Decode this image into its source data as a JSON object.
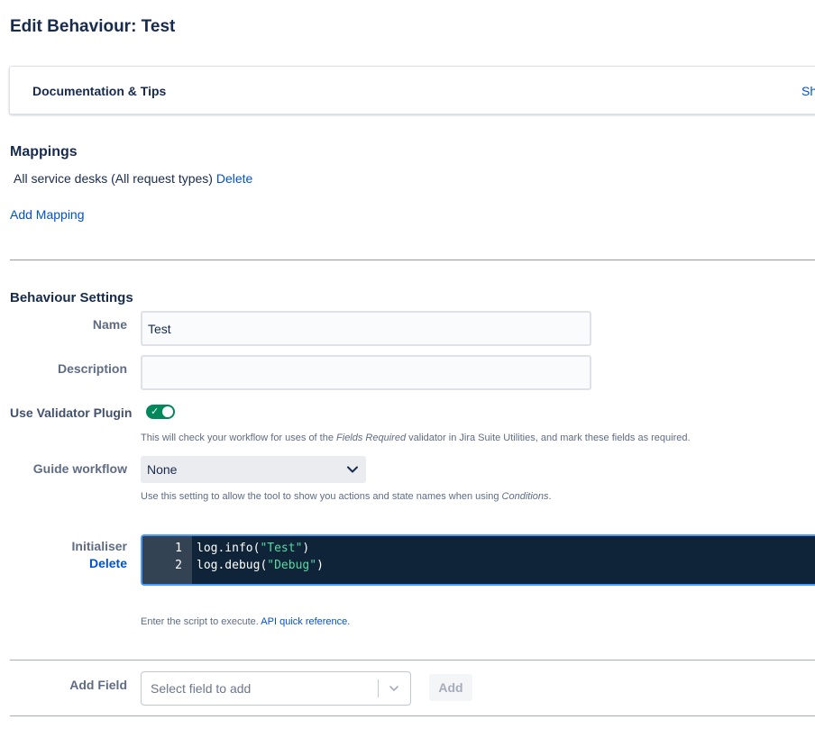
{
  "page": {
    "title": "Edit Behaviour: Test"
  },
  "documentation": {
    "title": "Documentation & Tips",
    "toggle_label": "Sh"
  },
  "mappings": {
    "title": "Mappings",
    "items": [
      {
        "text": "All service desks (All request types)",
        "delete_label": "Delete"
      }
    ],
    "add_label": "Add Mapping"
  },
  "settings": {
    "title": "Behaviour Settings",
    "name": {
      "label": "Name",
      "value": "Test"
    },
    "description": {
      "label": "Description",
      "value": ""
    },
    "validator": {
      "label": "Use Validator Plugin",
      "enabled": true,
      "help_prefix": "This will check your workflow for uses of the ",
      "help_em": "Fields Required",
      "help_suffix": " validator in Jira Suite Utilities, and mark these fields as required."
    },
    "guide_workflow": {
      "label": "Guide workflow",
      "selected": "None",
      "help_prefix": "Use this setting to allow the tool to show you actions and state names when using ",
      "help_em": "Conditions",
      "help_suffix": "."
    },
    "initialiser": {
      "label": "Initialiser",
      "delete_label": "Delete",
      "code_lines": [
        {
          "number": "1",
          "before": "log.info(",
          "string": "\"Test\"",
          "after": ")"
        },
        {
          "number": "2",
          "before": "log.debug(",
          "string": "\"Debug\"",
          "after": ")"
        }
      ],
      "help_prefix": "Enter the script to execute. ",
      "help_link": "API quick reference."
    }
  },
  "add_field": {
    "label": "Add Field",
    "placeholder": "Select field to add",
    "button_label": "Add"
  },
  "colors": {
    "link": "#0052cc",
    "toggle_on": "#00875a",
    "editor_bg": "#0f2438",
    "code_string": "#57d9a3"
  },
  "icons": {
    "toggle": "check-icon",
    "select": "chevron-down-icon",
    "combo": "chevron-down-icon"
  }
}
